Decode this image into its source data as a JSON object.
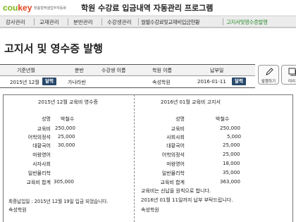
{
  "header": {
    "logo_part1": "cou",
    "logo_part2": "key",
    "logo_tagline": "맞춤형엑셀업무자동화",
    "title": "학원 수강료 입금내역 자동관리 프로그램"
  },
  "nav": {
    "items": [
      "강사관리",
      "교재관리",
      "분반관리",
      "수강생관리",
      "월별수강료및교재비입금현황",
      "고지서및영수증발행"
    ]
  },
  "page": {
    "title": "고지서 및 영수증 발행"
  },
  "form": {
    "headers": [
      "기준년월",
      "분반",
      "수강생 이름",
      "학원 이름",
      "납부일"
    ],
    "base_month": "2015년 12월",
    "class_name": "가나라반",
    "student_name": "",
    "academy_name": "속성학원",
    "payment_date": "2016-01-11",
    "calendar_button_label": "달력"
  },
  "side_buttons": [
    {
      "label": "발행하기",
      "icon": "pencil-icon"
    },
    {
      "label": "미리",
      "icon": "preview-icon"
    }
  ],
  "receipt": {
    "title": "2015년 12월 교육비 영수증",
    "col_name_header": "성명",
    "col_value_header": "박철수",
    "rows": [
      {
        "label": "교육비",
        "value": "250,000"
      },
      {
        "label": "어학의정석",
        "value": "25,000"
      },
      {
        "label": "대황국어",
        "value": "30,000"
      },
      {
        "label": "마왕영어",
        "value": ""
      },
      {
        "label": "사자사회",
        "value": ""
      },
      {
        "label": "일반물리학",
        "value": ""
      },
      {
        "label": "교육비 합계",
        "value": "305,000"
      }
    ],
    "payment_note": "최종납입일 : 2015년 12월 19일 입금 되었습니다.",
    "academy": "속성학원"
  },
  "notice": {
    "title": "2016년 01월 교육비 고지서",
    "col_name_header": "성명",
    "col_value_header": "박철수",
    "rows": [
      {
        "label": "교육비",
        "value": "250,000"
      },
      {
        "label": "사회사회",
        "value": "5,000"
      },
      {
        "label": "대황국어",
        "value": "25,000"
      },
      {
        "label": "어학의정석",
        "value": "25,000"
      },
      {
        "label": "마왕영어",
        "value": "18,000"
      },
      {
        "label": "일반물리학",
        "value": "35,000"
      },
      {
        "label": "교육비 합계",
        "value": "363,000"
      }
    ],
    "note_line1": "교육비는 선납을 원칙으로 합니다.",
    "note_line2": "2016년 01월 11일까지 납부 부탁드립니다.",
    "academy": "속성학원"
  }
}
